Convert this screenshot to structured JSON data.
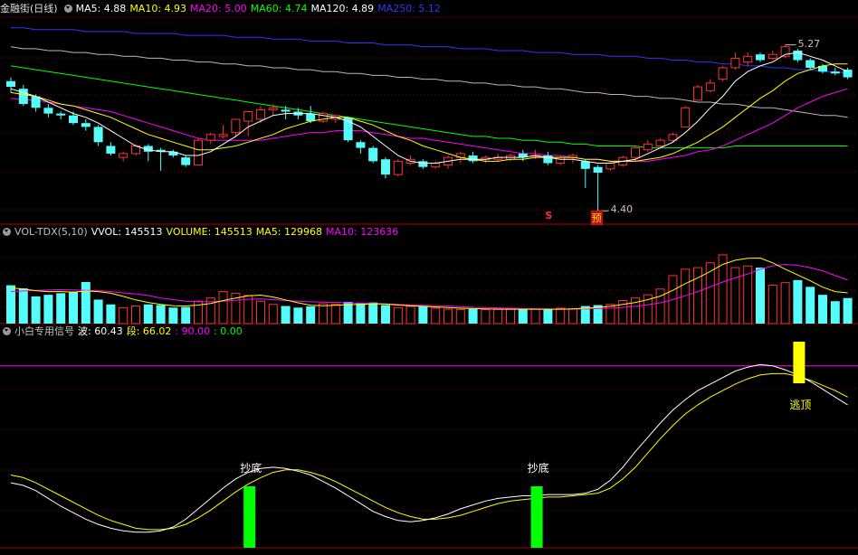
{
  "header_main": {
    "title": "金融街(日线)",
    "items": [
      {
        "label": "MA5: 4.88",
        "color": "#ffffff"
      },
      {
        "label": "MA10: 4.93",
        "color": "#ffff00"
      },
      {
        "label": "MA20: 5.00",
        "color": "#ff00ff"
      },
      {
        "label": "MA60: 4.74",
        "color": "#00ff00"
      },
      {
        "label": "MA120: 4.89",
        "color": "#ffffff"
      },
      {
        "label": "MA250: 5.12",
        "color": "#3333ff"
      }
    ]
  },
  "header_vol": {
    "items": [
      {
        "label": "VOL-TDX(5,10)",
        "color": "#c0c0c0"
      },
      {
        "label": "VVOL: 145513",
        "color": "#ffffff"
      },
      {
        "label": "VOLUME: 145513",
        "color": "#ffff00"
      },
      {
        "label": "MA5: 129968",
        "color": "#ffff00"
      },
      {
        "label": "MA10: 123636",
        "color": "#ff00ff"
      }
    ]
  },
  "header_ind": {
    "items": [
      {
        "label": "小白专用信号",
        "color": "#c0c0c0"
      },
      {
        "label": "波: 60.43",
        "color": "#ffffff"
      },
      {
        "label": "段: 66.02",
        "color": "#ffff00"
      },
      {
        "label": ": 90.00",
        "color": "#ff00ff"
      },
      {
        "label": ": 0.00",
        "color": "#00ff00"
      }
    ]
  },
  "annotations": {
    "high_label": "5.27",
    "low_label": "4.40",
    "s_mark": "S",
    "yu_mark": "预",
    "bottom1": "抄底",
    "bottom2": "抄底",
    "top": "逃顶"
  },
  "colors": {
    "up": "#ff3232",
    "down": "#54fcfc",
    "ma5": "#ffffff",
    "ma10": "#ffff00",
    "ma20": "#ff00ff",
    "ma60": "#00ff00",
    "ma120": "#ffffff",
    "ma250": "#3333ff",
    "bo": "#ffffff",
    "duan": "#ffff00",
    "line90": "#ff00ff",
    "buy_signal": "#00ff00",
    "sell_signal": "#ffff00",
    "grid": "#800000"
  },
  "chart_data": {
    "type": "candlestick",
    "price_high": 5.27,
    "price_low": 4.4,
    "candles": [
      {
        "o": 5.08,
        "c": 5.05,
        "h": 5.1,
        "l": 5.02
      },
      {
        "o": 5.04,
        "c": 4.96,
        "h": 5.06,
        "l": 4.95
      },
      {
        "o": 5.0,
        "c": 4.94,
        "h": 5.01,
        "l": 4.92
      },
      {
        "o": 4.94,
        "c": 4.91,
        "h": 4.96,
        "l": 4.89
      },
      {
        "o": 4.91,
        "c": 4.9,
        "h": 4.92,
        "l": 4.88
      },
      {
        "o": 4.9,
        "c": 4.86,
        "h": 4.92,
        "l": 4.85
      },
      {
        "o": 4.86,
        "c": 4.84,
        "h": 4.88,
        "l": 4.82
      },
      {
        "o": 4.84,
        "c": 4.76,
        "h": 4.85,
        "l": 4.74
      },
      {
        "o": 4.74,
        "c": 4.7,
        "h": 4.76,
        "l": 4.69
      },
      {
        "o": 4.68,
        "c": 4.7,
        "h": 4.71,
        "l": 4.66
      },
      {
        "o": 4.7,
        "c": 4.74,
        "h": 4.75,
        "l": 4.69
      },
      {
        "o": 4.74,
        "c": 4.71,
        "h": 4.75,
        "l": 4.66
      },
      {
        "o": 4.72,
        "c": 4.71,
        "h": 4.73,
        "l": 4.61
      },
      {
        "o": 4.71,
        "c": 4.69,
        "h": 4.72,
        "l": 4.68
      },
      {
        "o": 4.68,
        "c": 4.64,
        "h": 4.69,
        "l": 4.63
      },
      {
        "o": 4.64,
        "c": 4.77,
        "h": 4.78,
        "l": 4.64
      },
      {
        "o": 4.77,
        "c": 4.8,
        "h": 4.81,
        "l": 4.75
      },
      {
        "o": 4.79,
        "c": 4.8,
        "h": 4.85,
        "l": 4.78
      },
      {
        "o": 4.81,
        "c": 4.88,
        "h": 4.88,
        "l": 4.79
      },
      {
        "o": 4.87,
        "c": 4.92,
        "h": 4.92,
        "l": 4.79
      },
      {
        "o": 4.88,
        "c": 4.93,
        "h": 4.95,
        "l": 4.86
      },
      {
        "o": 4.93,
        "c": 4.94,
        "h": 4.96,
        "l": 4.9
      },
      {
        "o": 4.93,
        "c": 4.92,
        "h": 4.95,
        "l": 4.88
      },
      {
        "o": 4.92,
        "c": 4.9,
        "h": 4.94,
        "l": 4.88
      },
      {
        "o": 4.91,
        "c": 4.87,
        "h": 4.95,
        "l": 4.86
      },
      {
        "o": 4.87,
        "c": 4.91,
        "h": 4.92,
        "l": 4.86
      },
      {
        "o": 4.88,
        "c": 4.9,
        "h": 4.9,
        "l": 4.86
      },
      {
        "o": 4.89,
        "c": 4.77,
        "h": 4.89,
        "l": 4.76
      },
      {
        "o": 4.76,
        "c": 4.73,
        "h": 4.77,
        "l": 4.7
      },
      {
        "o": 4.73,
        "c": 4.66,
        "h": 4.74,
        "l": 4.65
      },
      {
        "o": 4.67,
        "c": 4.59,
        "h": 4.68,
        "l": 4.57
      },
      {
        "o": 4.59,
        "c": 4.66,
        "h": 4.67,
        "l": 4.58
      },
      {
        "o": 4.65,
        "c": 4.67,
        "h": 4.69,
        "l": 4.64
      },
      {
        "o": 4.66,
        "c": 4.63,
        "h": 4.67,
        "l": 4.62
      },
      {
        "o": 4.63,
        "c": 4.65,
        "h": 4.66,
        "l": 4.62
      },
      {
        "o": 4.64,
        "c": 4.68,
        "h": 4.69,
        "l": 4.62
      },
      {
        "o": 4.68,
        "c": 4.7,
        "h": 4.71,
        "l": 4.65
      },
      {
        "o": 4.69,
        "c": 4.66,
        "h": 4.71,
        "l": 4.65
      },
      {
        "o": 4.67,
        "c": 4.68,
        "h": 4.69,
        "l": 4.65
      },
      {
        "o": 4.67,
        "c": 4.68,
        "h": 4.7,
        "l": 4.66
      },
      {
        "o": 4.67,
        "c": 4.69,
        "h": 4.7,
        "l": 4.66
      },
      {
        "o": 4.7,
        "c": 4.68,
        "h": 4.72,
        "l": 4.66
      },
      {
        "o": 4.69,
        "c": 4.69,
        "h": 4.72,
        "l": 4.67
      },
      {
        "o": 4.69,
        "c": 4.65,
        "h": 4.71,
        "l": 4.64
      },
      {
        "o": 4.65,
        "c": 4.68,
        "h": 4.69,
        "l": 4.64
      },
      {
        "o": 4.68,
        "c": 4.69,
        "h": 4.7,
        "l": 4.65
      },
      {
        "o": 4.66,
        "c": 4.62,
        "h": 4.67,
        "l": 4.52
      },
      {
        "o": 4.63,
        "c": 4.6,
        "h": 4.64,
        "l": 4.4
      },
      {
        "o": 4.62,
        "c": 4.65,
        "h": 4.66,
        "l": 4.61
      },
      {
        "o": 4.64,
        "c": 4.68,
        "h": 4.69,
        "l": 4.63
      },
      {
        "o": 4.68,
        "c": 4.73,
        "h": 4.74,
        "l": 4.66
      },
      {
        "o": 4.72,
        "c": 4.75,
        "h": 4.77,
        "l": 4.71
      },
      {
        "o": 4.74,
        "c": 4.77,
        "h": 4.78,
        "l": 4.73
      },
      {
        "o": 4.77,
        "c": 4.8,
        "h": 4.81,
        "l": 4.76
      },
      {
        "o": 4.84,
        "c": 4.94,
        "h": 4.95,
        "l": 4.84
      },
      {
        "o": 4.98,
        "c": 5.05,
        "h": 5.06,
        "l": 4.98
      },
      {
        "o": 5.03,
        "c": 5.07,
        "h": 5.09,
        "l": 5.02
      },
      {
        "o": 5.09,
        "c": 5.15,
        "h": 5.16,
        "l": 5.08
      },
      {
        "o": 5.15,
        "c": 5.2,
        "h": 5.23,
        "l": 5.14
      },
      {
        "o": 5.18,
        "c": 5.21,
        "h": 5.23,
        "l": 5.16
      },
      {
        "o": 5.22,
        "c": 5.19,
        "h": 5.23,
        "l": 5.18
      },
      {
        "o": 5.2,
        "c": 5.22,
        "h": 5.24,
        "l": 5.19
      },
      {
        "o": 5.21,
        "c": 5.26,
        "h": 5.27,
        "l": 5.2
      },
      {
        "o": 5.24,
        "c": 5.19,
        "h": 5.25,
        "l": 5.18
      },
      {
        "o": 5.19,
        "c": 5.15,
        "h": 5.2,
        "l": 5.14
      },
      {
        "o": 5.16,
        "c": 5.13,
        "h": 5.17,
        "l": 5.12
      },
      {
        "o": 5.13,
        "c": 5.12,
        "h": 5.15,
        "l": 5.11
      },
      {
        "o": 5.14,
        "c": 5.1,
        "h": 5.15,
        "l": 5.09
      }
    ],
    "ma5": [
      5.04,
      5.02,
      5.0,
      4.97,
      4.94,
      4.91,
      4.89,
      4.86,
      4.82,
      4.78,
      4.74,
      4.72,
      4.71,
      4.71,
      4.69,
      4.69,
      4.71,
      4.75,
      4.79,
      4.84,
      4.87,
      4.9,
      4.91,
      4.91,
      4.91,
      4.9,
      4.89,
      4.87,
      4.84,
      4.79,
      4.74,
      4.69,
      4.66,
      4.65,
      4.65,
      4.66,
      4.67,
      4.67,
      4.67,
      4.68,
      4.68,
      4.68,
      4.69,
      4.68,
      4.67,
      4.67,
      4.66,
      4.65,
      4.65,
      4.66,
      4.67,
      4.7,
      4.73,
      4.76,
      4.81,
      4.87,
      4.94,
      5.0,
      5.08,
      5.13,
      5.16,
      5.18,
      5.22,
      5.23,
      5.21,
      5.19,
      5.16,
      5.13
    ],
    "ma10": [
      5.02,
      5.01,
      5.0,
      4.98,
      4.96,
      4.95,
      4.93,
      4.91,
      4.89,
      4.86,
      4.83,
      4.8,
      4.78,
      4.76,
      4.74,
      4.72,
      4.72,
      4.73,
      4.74,
      4.76,
      4.78,
      4.8,
      4.83,
      4.85,
      4.87,
      4.88,
      4.89,
      4.89,
      4.87,
      4.85,
      4.82,
      4.79,
      4.77,
      4.74,
      4.72,
      4.7,
      4.68,
      4.67,
      4.66,
      4.66,
      4.67,
      4.67,
      4.68,
      4.68,
      4.68,
      4.68,
      4.67,
      4.67,
      4.66,
      4.66,
      4.66,
      4.67,
      4.68,
      4.7,
      4.73,
      4.76,
      4.8,
      4.84,
      4.89,
      4.94,
      4.99,
      5.03,
      5.08,
      5.12,
      5.14,
      5.16,
      5.17,
      5.17
    ],
    "ma20": [
      4.99,
      4.98,
      4.98,
      4.97,
      4.96,
      4.95,
      4.94,
      4.93,
      4.92,
      4.9,
      4.88,
      4.86,
      4.84,
      4.82,
      4.8,
      4.78,
      4.77,
      4.77,
      4.77,
      4.77,
      4.77,
      4.78,
      4.79,
      4.8,
      4.81,
      4.81,
      4.82,
      4.82,
      4.82,
      4.81,
      4.8,
      4.79,
      4.78,
      4.78,
      4.77,
      4.76,
      4.75,
      4.74,
      4.73,
      4.72,
      4.71,
      4.7,
      4.7,
      4.69,
      4.69,
      4.68,
      4.67,
      4.67,
      4.66,
      4.66,
      4.66,
      4.66,
      4.67,
      4.68,
      4.69,
      4.71,
      4.72,
      4.74,
      4.77,
      4.8,
      4.83,
      4.86,
      4.9,
      4.94,
      4.97,
      5.0,
      5.02,
      5.04
    ],
    "ma60": [
      5.16,
      5.15,
      5.14,
      5.13,
      5.12,
      5.11,
      5.1,
      5.09,
      5.08,
      5.07,
      5.06,
      5.05,
      5.04,
      5.03,
      5.02,
      5.01,
      5.0,
      4.99,
      4.98,
      4.97,
      4.96,
      4.95,
      4.94,
      4.93,
      4.92,
      4.91,
      4.9,
      4.89,
      4.88,
      4.87,
      4.86,
      4.85,
      4.84,
      4.83,
      4.82,
      4.81,
      4.8,
      4.79,
      4.79,
      4.78,
      4.78,
      4.77,
      4.77,
      4.76,
      4.76,
      4.75,
      4.75,
      4.74,
      4.74,
      4.74,
      4.74,
      4.73,
      4.73,
      4.73,
      4.73,
      4.73,
      4.73,
      4.73,
      4.74,
      4.74,
      4.74,
      4.74,
      4.74,
      4.74,
      4.74,
      4.74,
      4.74,
      4.74
    ],
    "ma120": [
      5.26,
      5.25,
      5.25,
      5.24,
      5.24,
      5.23,
      5.23,
      5.22,
      5.22,
      5.21,
      5.21,
      5.2,
      5.2,
      5.19,
      5.19,
      5.18,
      5.18,
      5.17,
      5.17,
      5.16,
      5.16,
      5.15,
      5.15,
      5.14,
      5.14,
      5.13,
      5.13,
      5.12,
      5.12,
      5.11,
      5.11,
      5.1,
      5.1,
      5.09,
      5.09,
      5.08,
      5.08,
      5.07,
      5.07,
      5.06,
      5.06,
      5.05,
      5.05,
      5.04,
      5.04,
      5.03,
      5.02,
      5.02,
      5.01,
      5.01,
      5.0,
      5.0,
      4.99,
      4.99,
      4.98,
      4.97,
      4.97,
      4.96,
      4.96,
      4.95,
      4.94,
      4.94,
      4.93,
      4.92,
      4.91,
      4.9,
      4.9,
      4.89
    ],
    "ma250": [
      5.36,
      5.36,
      5.35,
      5.35,
      5.35,
      5.35,
      5.34,
      5.34,
      5.34,
      5.34,
      5.33,
      5.33,
      5.33,
      5.33,
      5.32,
      5.32,
      5.32,
      5.32,
      5.31,
      5.31,
      5.31,
      5.3,
      5.3,
      5.3,
      5.29,
      5.29,
      5.29,
      5.28,
      5.28,
      5.28,
      5.27,
      5.27,
      5.27,
      5.26,
      5.26,
      5.26,
      5.25,
      5.25,
      5.25,
      5.24,
      5.24,
      5.24,
      5.23,
      5.23,
      5.23,
      5.22,
      5.22,
      5.22,
      5.21,
      5.21,
      5.21,
      5.2,
      5.2,
      5.19,
      5.19,
      5.18,
      5.18,
      5.17,
      5.17,
      5.16,
      5.16,
      5.15,
      5.15,
      5.14,
      5.14,
      5.13,
      5.13,
      5.12
    ],
    "volume": [
      120000,
      110000,
      85000,
      90000,
      95000,
      100000,
      130000,
      75000,
      60000,
      50000,
      55000,
      60000,
      58000,
      50000,
      52000,
      70000,
      80000,
      100000,
      95000,
      88000,
      70000,
      60000,
      55000,
      50000,
      54000,
      62000,
      60000,
      68000,
      65000,
      66000,
      58000,
      50000,
      54000,
      55000,
      48000,
      45000,
      44000,
      46000,
      44000,
      46000,
      45000,
      44000,
      46000,
      45000,
      48000,
      46000,
      55000,
      58000,
      60000,
      72000,
      80000,
      90000,
      108000,
      150000,
      170000,
      175000,
      190000,
      215000,
      175000,
      180000,
      175000,
      120000,
      128000,
      136000,
      115000,
      90000,
      70000,
      80000
    ],
    "vol_max": 260000,
    "vol_ma5": [
      112000,
      108000,
      103000,
      100000,
      100000,
      98000,
      102000,
      100000,
      95000,
      85000,
      74000,
      66000,
      60000,
      56000,
      55000,
      58000,
      63000,
      72000,
      80000,
      87000,
      89000,
      83000,
      74000,
      65000,
      57000,
      56000,
      57000,
      59000,
      60000,
      62000,
      61000,
      58000,
      56000,
      54000,
      52000,
      50000,
      48000,
      47000,
      46000,
      45000,
      45000,
      45000,
      45000,
      45000,
      45000,
      46000,
      48000,
      51000,
      54000,
      60000,
      66000,
      75000,
      86000,
      104000,
      125000,
      143000,
      163000,
      185000,
      198000,
      204000,
      205000,
      190000,
      170000,
      152000,
      134000,
      114000,
      100000,
      96000
    ],
    "vol_ma10": [
      100000,
      102000,
      104000,
      105000,
      106000,
      105000,
      104000,
      103000,
      100000,
      96000,
      93000,
      88000,
      80000,
      75000,
      70000,
      68000,
      68000,
      70000,
      73000,
      76000,
      77000,
      75000,
      72000,
      70000,
      68000,
      67000,
      66000,
      65000,
      64000,
      63000,
      62000,
      60000,
      58000,
      57000,
      56000,
      55000,
      53000,
      51000,
      50000,
      49000,
      48000,
      47000,
      46000,
      46000,
      45000,
      45000,
      46000,
      47000,
      48000,
      51000,
      54000,
      59000,
      65000,
      75000,
      87000,
      100000,
      115000,
      130000,
      143000,
      155000,
      170000,
      180000,
      185000,
      182000,
      175000,
      165000,
      150000,
      136000
    ],
    "bo": [
      50,
      48,
      44,
      38,
      32,
      27,
      22,
      18,
      15,
      13,
      12,
      12,
      13,
      16,
      22,
      30,
      38,
      46,
      53,
      58,
      61,
      62,
      61,
      59,
      56,
      51,
      46,
      40,
      34,
      28,
      24,
      21,
      20,
      21,
      23,
      26,
      30,
      33,
      36,
      38,
      39,
      40,
      40,
      41,
      41,
      41,
      42,
      45,
      52,
      62,
      74,
      85,
      96,
      106,
      114,
      121,
      126,
      131,
      136,
      139,
      141,
      140,
      137,
      133,
      128,
      122,
      116,
      110
    ],
    "duan": [
      56,
      54,
      50,
      45,
      40,
      35,
      30,
      25,
      21,
      18,
      15,
      14,
      14,
      15,
      18,
      23,
      29,
      36,
      43,
      49,
      54,
      58,
      60,
      60,
      58,
      55,
      51,
      46,
      41,
      36,
      31,
      27,
      24,
      22,
      22,
      23,
      25,
      28,
      31,
      34,
      36,
      37,
      38,
      39,
      39,
      40,
      41,
      42,
      46,
      53,
      62,
      73,
      84,
      94,
      103,
      110,
      116,
      121,
      126,
      130,
      133,
      134,
      134,
      132,
      129,
      125,
      121,
      116
    ],
    "ind_min": 0,
    "ind_max": 160,
    "line90": 140,
    "signals": [
      {
        "type": "buy",
        "index": 19,
        "label": "抄底"
      },
      {
        "type": "buy",
        "index": 42,
        "label": "抄底"
      },
      {
        "type": "sell",
        "index": 63,
        "label": "逃顶"
      }
    ]
  }
}
